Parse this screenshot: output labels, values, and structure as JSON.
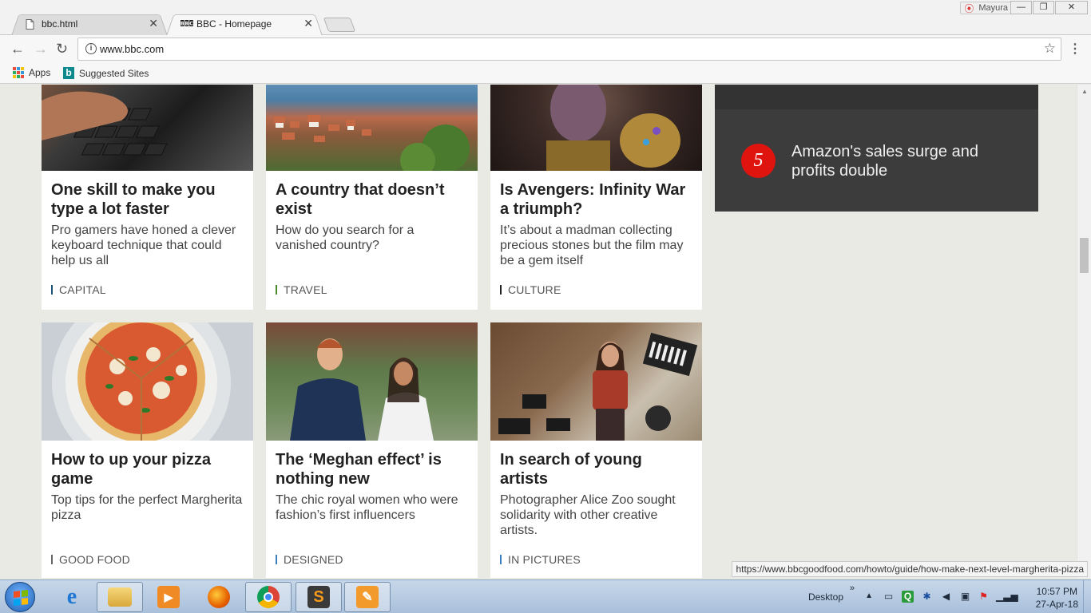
{
  "browser": {
    "tabs": [
      {
        "title": "bbc.html",
        "active": false
      },
      {
        "title": "BBC - Homepage",
        "active": true,
        "favicon": "BBC"
      }
    ],
    "profile": "Mayura",
    "url": "www.bbc.com",
    "bookmarks": [
      {
        "label": "Apps",
        "icon": "apps-grid-icon"
      },
      {
        "label": "Suggested Sites",
        "icon": "bing-icon"
      }
    ],
    "status_url": "https://www.bbcgoodfood.com/howto/guide/how-make-next-level-margherita-pizza"
  },
  "cards": [
    {
      "title": "One skill to make you type a lot faster",
      "summary": "Pro gamers have honed a clever keyboard technique that could help us all",
      "tag": "CAPITAL"
    },
    {
      "title": "A country that doesn’t exist",
      "summary": "How do you search for a vanished country?",
      "tag": "TRAVEL"
    },
    {
      "title": "Is Avengers: Infinity War a triumph?",
      "summary": "It’s about a madman collecting precious stones but the film may be a gem itself",
      "tag": "CULTURE"
    },
    {
      "title": "How to up your pizza game",
      "summary": "Top tips for the perfect Margherita pizza",
      "tag": "GOOD FOOD"
    },
    {
      "title": "The ‘Meghan effect’ is nothing new",
      "summary": "The chic royal women who were fashion’s first influencers",
      "tag": "DESIGNED"
    },
    {
      "title": "In search of young artists",
      "summary": "Photographer Alice Zoo sought solidarity with other creative artists.",
      "tag": "IN PICTURES"
    }
  ],
  "most_read": {
    "rank": "5",
    "headline": "Amazon's sales surge and profits double"
  },
  "taskbar": {
    "desktop_label": "Desktop",
    "time": "10:57 PM",
    "date": "27-Apr-18"
  },
  "colors": {
    "most_read_bg": "#3c3c3c",
    "rank_red": "#e0140f",
    "page_bg": "#eaeae5"
  }
}
